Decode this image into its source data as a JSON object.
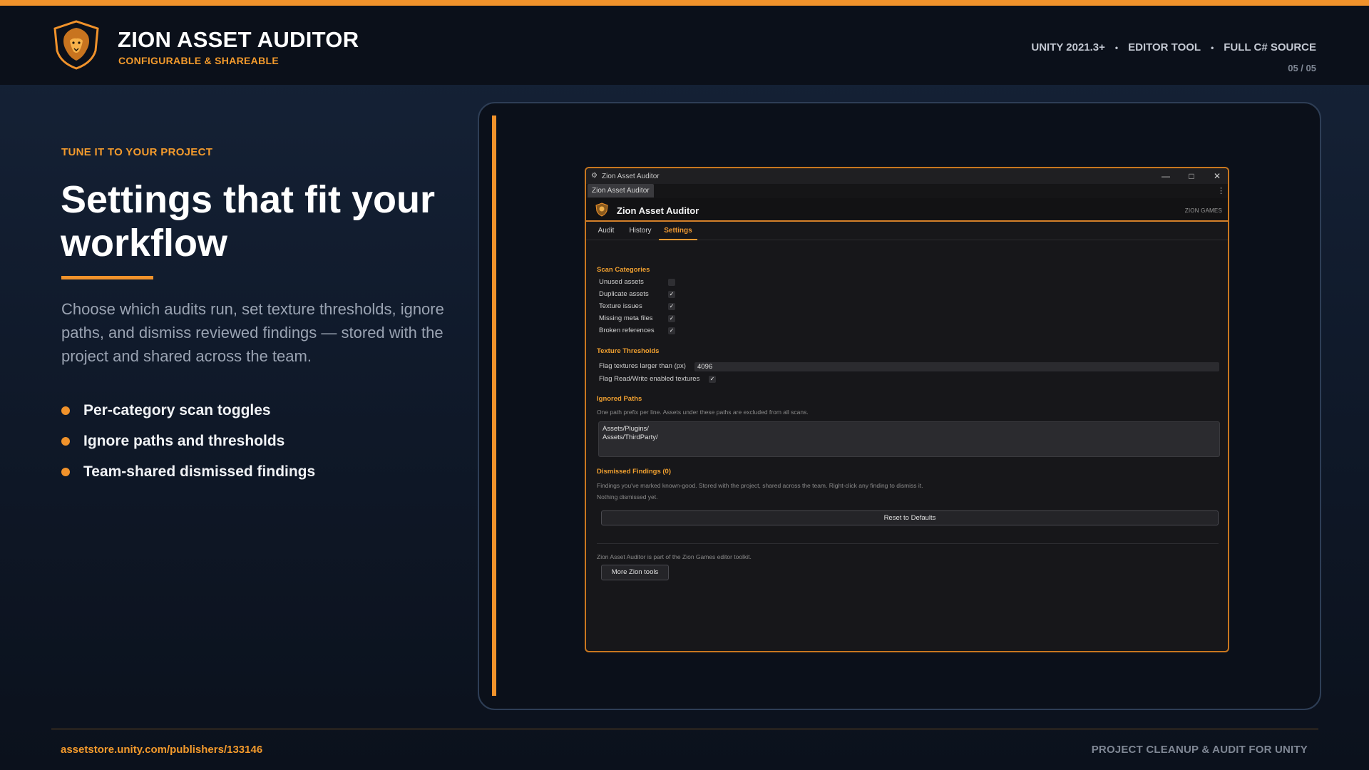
{
  "header": {
    "title": "ZION ASSET AUDITOR",
    "subtitle": "CONFIGURABLE & SHAREABLE",
    "meta": [
      "UNITY 2021.3+",
      "EDITOR TOOL",
      "FULL C# SOURCE"
    ],
    "separator": "•",
    "page": "05 / 05"
  },
  "hero": {
    "eyebrow": "TUNE IT TO YOUR PROJECT",
    "headline": "Settings that fit your workflow",
    "description": "Choose which audits run, set texture thresholds, ignore paths, and dismiss reviewed findings — stored with the project and shared across the team.",
    "bullets": [
      "Per-category scan toggles",
      "Ignore paths and thresholds",
      "Team-shared dismissed findings"
    ]
  },
  "window": {
    "title": "Zion Asset Auditor",
    "doc_tab": "Zion Asset Auditor",
    "controls": {
      "minimize": "—",
      "maximize": "□",
      "close": "✕"
    },
    "kebab": "⋮",
    "app_title": "Zion Asset Auditor",
    "app_brand": "ZION GAMES",
    "tabs": [
      "Audit",
      "History",
      "Settings"
    ],
    "active_tab": "Settings",
    "scan_categories": {
      "title": "Scan Categories",
      "items": [
        {
          "label": "Unused assets",
          "checked": false
        },
        {
          "label": "Duplicate assets",
          "checked": true
        },
        {
          "label": "Texture issues",
          "checked": true
        },
        {
          "label": "Missing meta files",
          "checked": true
        },
        {
          "label": "Broken references",
          "checked": true
        }
      ]
    },
    "texture_thresholds": {
      "title": "Texture Thresholds",
      "size_label": "Flag textures larger than (px)",
      "size_value": "4096",
      "rw_label": "Flag Read/Write enabled textures",
      "rw_checked": true
    },
    "ignored_paths": {
      "title": "Ignored Paths",
      "help": "One path prefix per line. Assets under these paths are excluded from all scans.",
      "lines": [
        "Assets/Plugins/",
        "Assets/ThirdParty/"
      ]
    },
    "dismissed": {
      "title": "Dismissed Findings (0)",
      "help": "Findings you've marked known-good. Stored with the project, shared across the team. Right-click any finding to dismiss it.",
      "empty": "Nothing dismissed yet."
    },
    "reset_button": "Reset to Defaults",
    "toolkit_note": "Zion Asset Auditor is part of the Zion Games editor toolkit.",
    "more_button": "More Zion tools"
  },
  "footer": {
    "link": "assetstore.unity.com/publishers/133146",
    "tagline": "PROJECT CLEANUP & AUDIT FOR UNITY"
  },
  "colors": {
    "accent": "#f0922b",
    "background": "#101a2b",
    "window_bg": "#17171a"
  }
}
